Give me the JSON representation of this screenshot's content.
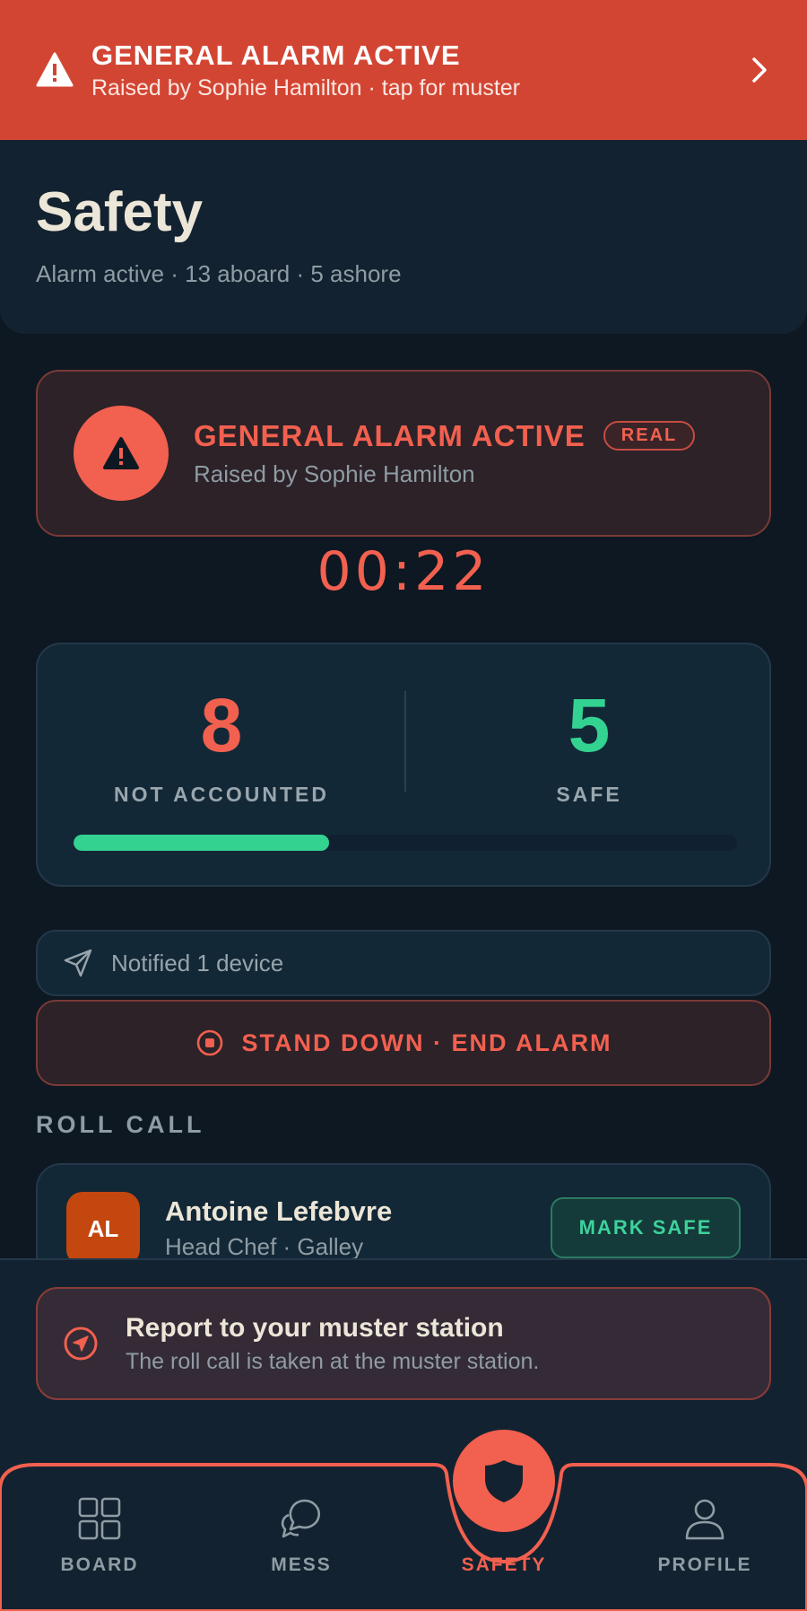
{
  "alarm_banner": {
    "title": "GENERAL ALARM ACTIVE",
    "subtitle": "Raised by Sophie Hamilton · tap for muster",
    "icon": "warning-icon",
    "chevron_icon": "chevron-right-icon",
    "color": "#d34533"
  },
  "header": {
    "title": "Safety",
    "subtitle": "Alarm active · 13 aboard · 5 ashore"
  },
  "alert_card": {
    "title": "GENERAL ALARM ACTIVE",
    "badge": "REAL",
    "subtitle": "Raised by Sophie Hamilton",
    "icon": "warning-icon",
    "accent": "#f2604f"
  },
  "timer": "00:22",
  "stats": {
    "not_accounted_value": "8",
    "not_accounted_label": "NOT ACCOUNTED",
    "safe_value": "5",
    "safe_label": "SAFE",
    "safe_fraction": 0.3846,
    "safe_color": "#33d291",
    "not_accounted_color": "#f2604f"
  },
  "notify": {
    "text": "Notified 1 device",
    "icon": "send-icon"
  },
  "stand_down": {
    "label": "STAND DOWN · END ALARM",
    "icon": "stop-circle-icon"
  },
  "roll_call": {
    "title": "ROLL CALL",
    "rows": [
      {
        "initials": "AL",
        "name": "Antoine Lefebvre",
        "role": "Head Chef · Galley",
        "action": "MARK SAFE"
      }
    ]
  },
  "muster": {
    "title": "Report to your muster station",
    "subtitle": "The roll call is taken at the muster station.",
    "icon": "navigation-icon"
  },
  "tabs": [
    {
      "label": "BOARD",
      "icon": "grid-icon",
      "active": false
    },
    {
      "label": "MESS",
      "icon": "chat-bubbles-icon",
      "active": false
    },
    {
      "label": "SAFETY",
      "icon": "shield-icon",
      "active": true
    },
    {
      "label": "PROFILE",
      "icon": "user-icon",
      "active": false
    }
  ]
}
